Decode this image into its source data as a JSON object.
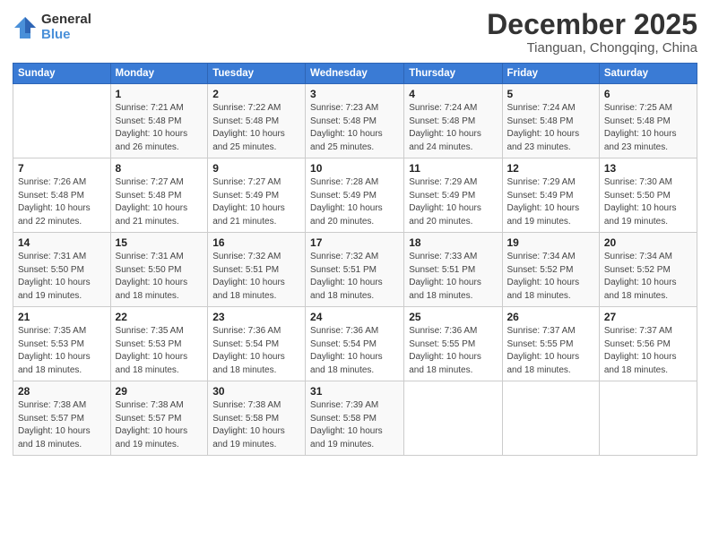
{
  "logo": {
    "general": "General",
    "blue": "Blue"
  },
  "title": "December 2025",
  "location": "Tianguan, Chongqing, China",
  "headers": [
    "Sunday",
    "Monday",
    "Tuesday",
    "Wednesday",
    "Thursday",
    "Friday",
    "Saturday"
  ],
  "weeks": [
    [
      {
        "day": "",
        "info": ""
      },
      {
        "day": "1",
        "info": "Sunrise: 7:21 AM\nSunset: 5:48 PM\nDaylight: 10 hours\nand 26 minutes."
      },
      {
        "day": "2",
        "info": "Sunrise: 7:22 AM\nSunset: 5:48 PM\nDaylight: 10 hours\nand 25 minutes."
      },
      {
        "day": "3",
        "info": "Sunrise: 7:23 AM\nSunset: 5:48 PM\nDaylight: 10 hours\nand 25 minutes."
      },
      {
        "day": "4",
        "info": "Sunrise: 7:24 AM\nSunset: 5:48 PM\nDaylight: 10 hours\nand 24 minutes."
      },
      {
        "day": "5",
        "info": "Sunrise: 7:24 AM\nSunset: 5:48 PM\nDaylight: 10 hours\nand 23 minutes."
      },
      {
        "day": "6",
        "info": "Sunrise: 7:25 AM\nSunset: 5:48 PM\nDaylight: 10 hours\nand 23 minutes."
      }
    ],
    [
      {
        "day": "7",
        "info": "Sunrise: 7:26 AM\nSunset: 5:48 PM\nDaylight: 10 hours\nand 22 minutes."
      },
      {
        "day": "8",
        "info": "Sunrise: 7:27 AM\nSunset: 5:48 PM\nDaylight: 10 hours\nand 21 minutes."
      },
      {
        "day": "9",
        "info": "Sunrise: 7:27 AM\nSunset: 5:49 PM\nDaylight: 10 hours\nand 21 minutes."
      },
      {
        "day": "10",
        "info": "Sunrise: 7:28 AM\nSunset: 5:49 PM\nDaylight: 10 hours\nand 20 minutes."
      },
      {
        "day": "11",
        "info": "Sunrise: 7:29 AM\nSunset: 5:49 PM\nDaylight: 10 hours\nand 20 minutes."
      },
      {
        "day": "12",
        "info": "Sunrise: 7:29 AM\nSunset: 5:49 PM\nDaylight: 10 hours\nand 19 minutes."
      },
      {
        "day": "13",
        "info": "Sunrise: 7:30 AM\nSunset: 5:50 PM\nDaylight: 10 hours\nand 19 minutes."
      }
    ],
    [
      {
        "day": "14",
        "info": "Sunrise: 7:31 AM\nSunset: 5:50 PM\nDaylight: 10 hours\nand 19 minutes."
      },
      {
        "day": "15",
        "info": "Sunrise: 7:31 AM\nSunset: 5:50 PM\nDaylight: 10 hours\nand 18 minutes."
      },
      {
        "day": "16",
        "info": "Sunrise: 7:32 AM\nSunset: 5:51 PM\nDaylight: 10 hours\nand 18 minutes."
      },
      {
        "day": "17",
        "info": "Sunrise: 7:32 AM\nSunset: 5:51 PM\nDaylight: 10 hours\nand 18 minutes."
      },
      {
        "day": "18",
        "info": "Sunrise: 7:33 AM\nSunset: 5:51 PM\nDaylight: 10 hours\nand 18 minutes."
      },
      {
        "day": "19",
        "info": "Sunrise: 7:34 AM\nSunset: 5:52 PM\nDaylight: 10 hours\nand 18 minutes."
      },
      {
        "day": "20",
        "info": "Sunrise: 7:34 AM\nSunset: 5:52 PM\nDaylight: 10 hours\nand 18 minutes."
      }
    ],
    [
      {
        "day": "21",
        "info": "Sunrise: 7:35 AM\nSunset: 5:53 PM\nDaylight: 10 hours\nand 18 minutes."
      },
      {
        "day": "22",
        "info": "Sunrise: 7:35 AM\nSunset: 5:53 PM\nDaylight: 10 hours\nand 18 minutes."
      },
      {
        "day": "23",
        "info": "Sunrise: 7:36 AM\nSunset: 5:54 PM\nDaylight: 10 hours\nand 18 minutes."
      },
      {
        "day": "24",
        "info": "Sunrise: 7:36 AM\nSunset: 5:54 PM\nDaylight: 10 hours\nand 18 minutes."
      },
      {
        "day": "25",
        "info": "Sunrise: 7:36 AM\nSunset: 5:55 PM\nDaylight: 10 hours\nand 18 minutes."
      },
      {
        "day": "26",
        "info": "Sunrise: 7:37 AM\nSunset: 5:55 PM\nDaylight: 10 hours\nand 18 minutes."
      },
      {
        "day": "27",
        "info": "Sunrise: 7:37 AM\nSunset: 5:56 PM\nDaylight: 10 hours\nand 18 minutes."
      }
    ],
    [
      {
        "day": "28",
        "info": "Sunrise: 7:38 AM\nSunset: 5:57 PM\nDaylight: 10 hours\nand 18 minutes."
      },
      {
        "day": "29",
        "info": "Sunrise: 7:38 AM\nSunset: 5:57 PM\nDaylight: 10 hours\nand 19 minutes."
      },
      {
        "day": "30",
        "info": "Sunrise: 7:38 AM\nSunset: 5:58 PM\nDaylight: 10 hours\nand 19 minutes."
      },
      {
        "day": "31",
        "info": "Sunrise: 7:39 AM\nSunset: 5:58 PM\nDaylight: 10 hours\nand 19 minutes."
      },
      {
        "day": "",
        "info": ""
      },
      {
        "day": "",
        "info": ""
      },
      {
        "day": "",
        "info": ""
      }
    ]
  ]
}
